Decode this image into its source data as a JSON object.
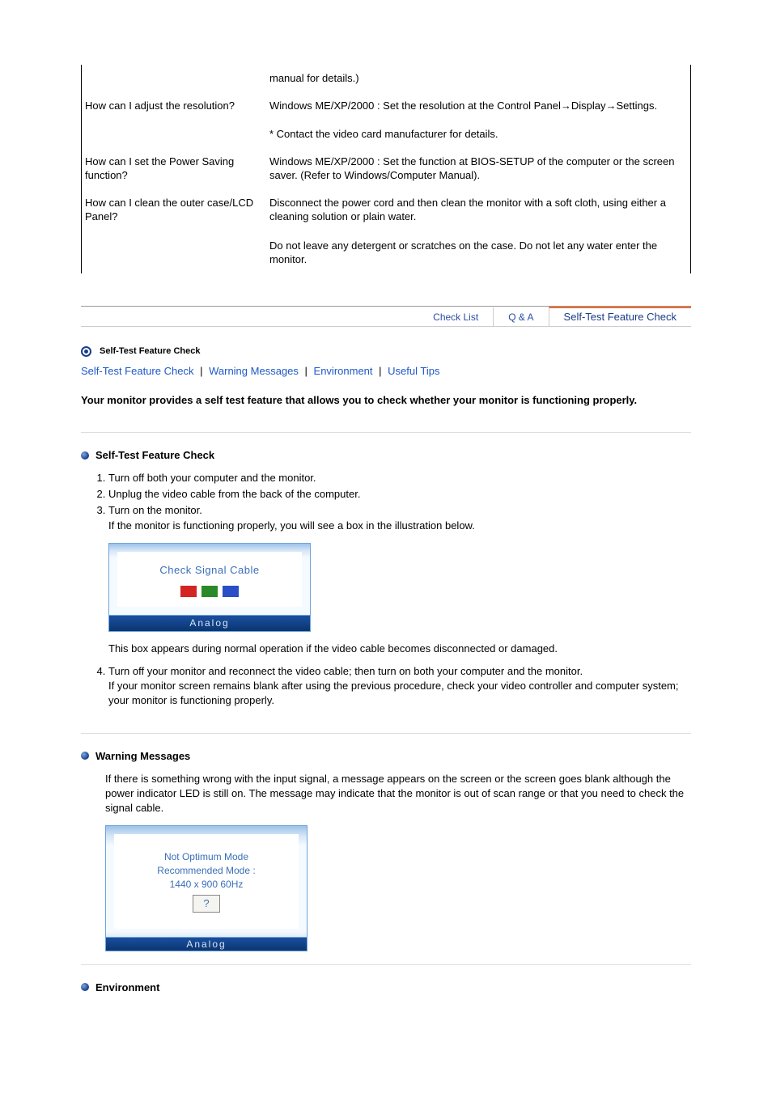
{
  "qa": {
    "r0": {
      "q": "",
      "a": "manual for details.)"
    },
    "r1": {
      "q": "How can I adjust the resolution?",
      "a1": "Windows ME/XP/2000 : Set the resolution at the Control Panel→Display→Settings.",
      "a2": "* Contact the video card manufacturer for details."
    },
    "r2": {
      "q": "How can I set the Power Saving function?",
      "a": "Windows ME/XP/2000 : Set the function at BIOS-SETUP of the computer or the screen saver. (Refer to Windows/Computer Manual)."
    },
    "r3": {
      "q": "How can I clean the outer case/LCD Panel?",
      "a1": "Disconnect the power cord and then clean the monitor with a soft cloth, using either a cleaning solution or plain water.",
      "a2": "Do not leave any detergent or scratches on the case. Do not let any water enter the monitor."
    }
  },
  "tabs": {
    "check": "Check List",
    "qa": "Q & A",
    "selftest": "Self-Test Feature Check"
  },
  "section": {
    "head_title": "Self-Test Feature Check",
    "links": {
      "selftest": "Self-Test Feature Check",
      "warning": "Warning Messages",
      "env": "Environment",
      "tips": "Useful Tips"
    },
    "intro": "Your monitor provides a self test feature that allows you to check whether your monitor is functioning properly."
  },
  "stfc": {
    "header": "Self-Test Feature Check",
    "step1": "Turn off both your computer and the monitor.",
    "step2": "Unplug the video cable from the back of the computer.",
    "step3": "Turn on the monitor.",
    "step3_body": "If the monitor is functioning properly, you will see a box in the illustration below.",
    "box": {
      "title": "Check Signal Cable",
      "mode": "Analog"
    },
    "step3_after": "This box appears during normal operation if the video cable becomes disconnected or damaged.",
    "step4": "Turn off your monitor and reconnect the video cable; then turn on both your computer and the monitor.",
    "step4_body": "If your monitor screen remains blank after using the previous procedure, check your video controller and computer system; your monitor is functioning properly."
  },
  "warn": {
    "header": "Warning Messages",
    "body": "If there is something wrong with the input signal, a message appears on the screen or the screen goes blank although the power indicator LED is still on. The message may indicate that the monitor is out of scan range or that you need to check the signal cable.",
    "box": {
      "l1": "Not Optimum Mode",
      "l2": "Recommended Mode :",
      "l3": "1440 x 900   60Hz",
      "q": "?",
      "mode": "Analog"
    }
  },
  "env": {
    "header": "Environment"
  }
}
